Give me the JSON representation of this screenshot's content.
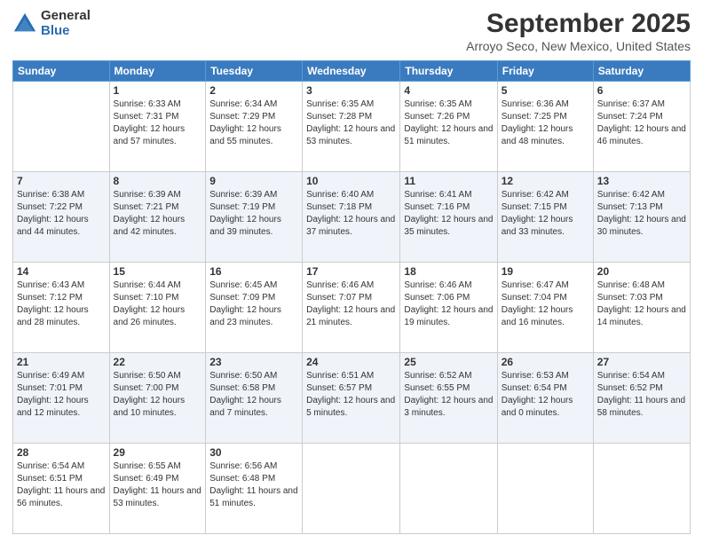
{
  "logo": {
    "general": "General",
    "blue": "Blue"
  },
  "header": {
    "title": "September 2025",
    "subtitle": "Arroyo Seco, New Mexico, United States"
  },
  "days_of_week": [
    "Sunday",
    "Monday",
    "Tuesday",
    "Wednesday",
    "Thursday",
    "Friday",
    "Saturday"
  ],
  "weeks": [
    [
      {
        "num": "",
        "sunrise": "",
        "sunset": "",
        "daylight": ""
      },
      {
        "num": "1",
        "sunrise": "Sunrise: 6:33 AM",
        "sunset": "Sunset: 7:31 PM",
        "daylight": "Daylight: 12 hours and 57 minutes."
      },
      {
        "num": "2",
        "sunrise": "Sunrise: 6:34 AM",
        "sunset": "Sunset: 7:29 PM",
        "daylight": "Daylight: 12 hours and 55 minutes."
      },
      {
        "num": "3",
        "sunrise": "Sunrise: 6:35 AM",
        "sunset": "Sunset: 7:28 PM",
        "daylight": "Daylight: 12 hours and 53 minutes."
      },
      {
        "num": "4",
        "sunrise": "Sunrise: 6:35 AM",
        "sunset": "Sunset: 7:26 PM",
        "daylight": "Daylight: 12 hours and 51 minutes."
      },
      {
        "num": "5",
        "sunrise": "Sunrise: 6:36 AM",
        "sunset": "Sunset: 7:25 PM",
        "daylight": "Daylight: 12 hours and 48 minutes."
      },
      {
        "num": "6",
        "sunrise": "Sunrise: 6:37 AM",
        "sunset": "Sunset: 7:24 PM",
        "daylight": "Daylight: 12 hours and 46 minutes."
      }
    ],
    [
      {
        "num": "7",
        "sunrise": "Sunrise: 6:38 AM",
        "sunset": "Sunset: 7:22 PM",
        "daylight": "Daylight: 12 hours and 44 minutes."
      },
      {
        "num": "8",
        "sunrise": "Sunrise: 6:39 AM",
        "sunset": "Sunset: 7:21 PM",
        "daylight": "Daylight: 12 hours and 42 minutes."
      },
      {
        "num": "9",
        "sunrise": "Sunrise: 6:39 AM",
        "sunset": "Sunset: 7:19 PM",
        "daylight": "Daylight: 12 hours and 39 minutes."
      },
      {
        "num": "10",
        "sunrise": "Sunrise: 6:40 AM",
        "sunset": "Sunset: 7:18 PM",
        "daylight": "Daylight: 12 hours and 37 minutes."
      },
      {
        "num": "11",
        "sunrise": "Sunrise: 6:41 AM",
        "sunset": "Sunset: 7:16 PM",
        "daylight": "Daylight: 12 hours and 35 minutes."
      },
      {
        "num": "12",
        "sunrise": "Sunrise: 6:42 AM",
        "sunset": "Sunset: 7:15 PM",
        "daylight": "Daylight: 12 hours and 33 minutes."
      },
      {
        "num": "13",
        "sunrise": "Sunrise: 6:42 AM",
        "sunset": "Sunset: 7:13 PM",
        "daylight": "Daylight: 12 hours and 30 minutes."
      }
    ],
    [
      {
        "num": "14",
        "sunrise": "Sunrise: 6:43 AM",
        "sunset": "Sunset: 7:12 PM",
        "daylight": "Daylight: 12 hours and 28 minutes."
      },
      {
        "num": "15",
        "sunrise": "Sunrise: 6:44 AM",
        "sunset": "Sunset: 7:10 PM",
        "daylight": "Daylight: 12 hours and 26 minutes."
      },
      {
        "num": "16",
        "sunrise": "Sunrise: 6:45 AM",
        "sunset": "Sunset: 7:09 PM",
        "daylight": "Daylight: 12 hours and 23 minutes."
      },
      {
        "num": "17",
        "sunrise": "Sunrise: 6:46 AM",
        "sunset": "Sunset: 7:07 PM",
        "daylight": "Daylight: 12 hours and 21 minutes."
      },
      {
        "num": "18",
        "sunrise": "Sunrise: 6:46 AM",
        "sunset": "Sunset: 7:06 PM",
        "daylight": "Daylight: 12 hours and 19 minutes."
      },
      {
        "num": "19",
        "sunrise": "Sunrise: 6:47 AM",
        "sunset": "Sunset: 7:04 PM",
        "daylight": "Daylight: 12 hours and 16 minutes."
      },
      {
        "num": "20",
        "sunrise": "Sunrise: 6:48 AM",
        "sunset": "Sunset: 7:03 PM",
        "daylight": "Daylight: 12 hours and 14 minutes."
      }
    ],
    [
      {
        "num": "21",
        "sunrise": "Sunrise: 6:49 AM",
        "sunset": "Sunset: 7:01 PM",
        "daylight": "Daylight: 12 hours and 12 minutes."
      },
      {
        "num": "22",
        "sunrise": "Sunrise: 6:50 AM",
        "sunset": "Sunset: 7:00 PM",
        "daylight": "Daylight: 12 hours and 10 minutes."
      },
      {
        "num": "23",
        "sunrise": "Sunrise: 6:50 AM",
        "sunset": "Sunset: 6:58 PM",
        "daylight": "Daylight: 12 hours and 7 minutes."
      },
      {
        "num": "24",
        "sunrise": "Sunrise: 6:51 AM",
        "sunset": "Sunset: 6:57 PM",
        "daylight": "Daylight: 12 hours and 5 minutes."
      },
      {
        "num": "25",
        "sunrise": "Sunrise: 6:52 AM",
        "sunset": "Sunset: 6:55 PM",
        "daylight": "Daylight: 12 hours and 3 minutes."
      },
      {
        "num": "26",
        "sunrise": "Sunrise: 6:53 AM",
        "sunset": "Sunset: 6:54 PM",
        "daylight": "Daylight: 12 hours and 0 minutes."
      },
      {
        "num": "27",
        "sunrise": "Sunrise: 6:54 AM",
        "sunset": "Sunset: 6:52 PM",
        "daylight": "Daylight: 11 hours and 58 minutes."
      }
    ],
    [
      {
        "num": "28",
        "sunrise": "Sunrise: 6:54 AM",
        "sunset": "Sunset: 6:51 PM",
        "daylight": "Daylight: 11 hours and 56 minutes."
      },
      {
        "num": "29",
        "sunrise": "Sunrise: 6:55 AM",
        "sunset": "Sunset: 6:49 PM",
        "daylight": "Daylight: 11 hours and 53 minutes."
      },
      {
        "num": "30",
        "sunrise": "Sunrise: 6:56 AM",
        "sunset": "Sunset: 6:48 PM",
        "daylight": "Daylight: 11 hours and 51 minutes."
      },
      {
        "num": "",
        "sunrise": "",
        "sunset": "",
        "daylight": ""
      },
      {
        "num": "",
        "sunrise": "",
        "sunset": "",
        "daylight": ""
      },
      {
        "num": "",
        "sunrise": "",
        "sunset": "",
        "daylight": ""
      },
      {
        "num": "",
        "sunrise": "",
        "sunset": "",
        "daylight": ""
      }
    ]
  ]
}
